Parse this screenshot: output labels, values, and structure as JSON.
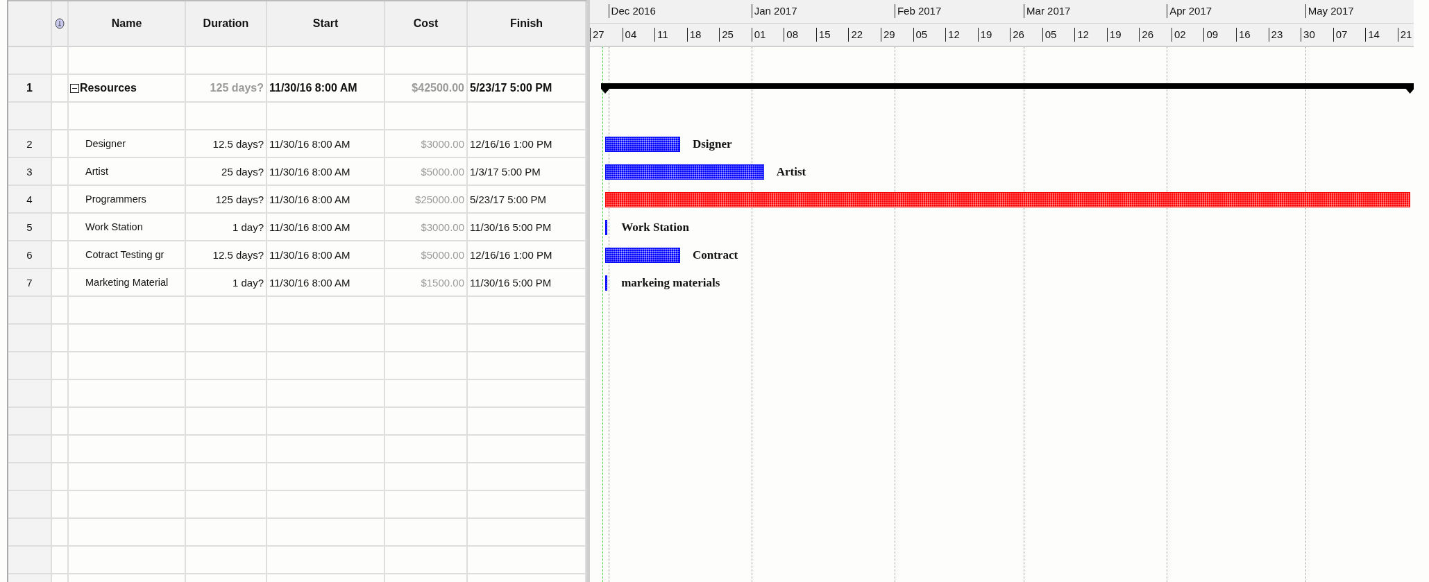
{
  "table": {
    "columns": [
      {
        "kind": "id"
      },
      {
        "kind": "indicator"
      },
      {
        "kind": "name",
        "label": "Name"
      },
      {
        "kind": "duration",
        "label": "Duration"
      },
      {
        "kind": "start",
        "label": "Start"
      },
      {
        "kind": "cost",
        "label": "Cost"
      },
      {
        "kind": "finish",
        "label": "Finish"
      }
    ],
    "rows": [
      {
        "kind": "blank"
      },
      {
        "kind": "summary",
        "id": "1",
        "name": "Resources",
        "expanded": true,
        "duration": "125 days?",
        "start": "11/30/16 8:00 AM",
        "cost": "$42500.00",
        "finish": "5/23/17 5:00 PM",
        "bar": {
          "kind": "summary"
        }
      },
      {
        "kind": "blank"
      },
      {
        "kind": "task",
        "id": "2",
        "name": "Designer",
        "duration": "12.5 days?",
        "start": "11/30/16 8:00 AM",
        "cost": "$3000.00",
        "finish": "12/16/16 1:00 PM",
        "bar": {
          "kind": "task",
          "color": "#0000ff",
          "label": "Dsigner"
        }
      },
      {
        "kind": "task",
        "id": "3",
        "name": "Artist",
        "duration": "25 days?",
        "start": "11/30/16 8:00 AM",
        "cost": "$5000.00",
        "finish": "1/3/17 5:00 PM",
        "bar": {
          "kind": "task",
          "color": "#0000ff",
          "label": "Artist"
        }
      },
      {
        "kind": "task",
        "id": "4",
        "name": "Programmers",
        "duration": "125 days?",
        "start": "11/30/16 8:00 AM",
        "cost": "$25000.00",
        "finish": "5/23/17 5:00 PM",
        "bar": {
          "kind": "task",
          "color": "#ff0000"
        }
      },
      {
        "kind": "task",
        "id": "5",
        "name": "Work Station",
        "duration": "1 day?",
        "start": "11/30/16 8:00 AM",
        "cost": "$3000.00",
        "finish": "11/30/16 5:00 PM",
        "bar": {
          "kind": "task",
          "color": "#0000ff",
          "label": "Work Station"
        }
      },
      {
        "kind": "task",
        "id": "6",
        "name": "Cotract Testing gr",
        "duration": "12.5 days?",
        "start": "11/30/16 8:00 AM",
        "cost": "$5000.00",
        "finish": "12/16/16 1:00 PM",
        "bar": {
          "kind": "task",
          "color": "#0000ff",
          "label": "Contract"
        }
      },
      {
        "kind": "task",
        "id": "7",
        "name": "Marketing Material",
        "duration": "1 day?",
        "start": "11/30/16 8:00 AM",
        "cost": "$1500.00",
        "finish": "11/30/16 5:00 PM",
        "bar": {
          "kind": "task",
          "color": "#0000ff",
          "label": "markeing materials"
        }
      }
    ]
  },
  "gantt": {
    "timescale": {
      "months": [
        "Dec 2016",
        "Jan 2017",
        "Feb 2017",
        "Mar 2017",
        "Apr 2017",
        "May 2017"
      ],
      "weeks": [
        "27",
        "04",
        "11",
        "18",
        "25",
        "01",
        "08",
        "15",
        "22",
        "29",
        "05",
        "12",
        "19",
        "26",
        "05",
        "12",
        "19",
        "26",
        "02",
        "09",
        "16",
        "23",
        "30",
        "07",
        "14",
        "21"
      ]
    }
  }
}
